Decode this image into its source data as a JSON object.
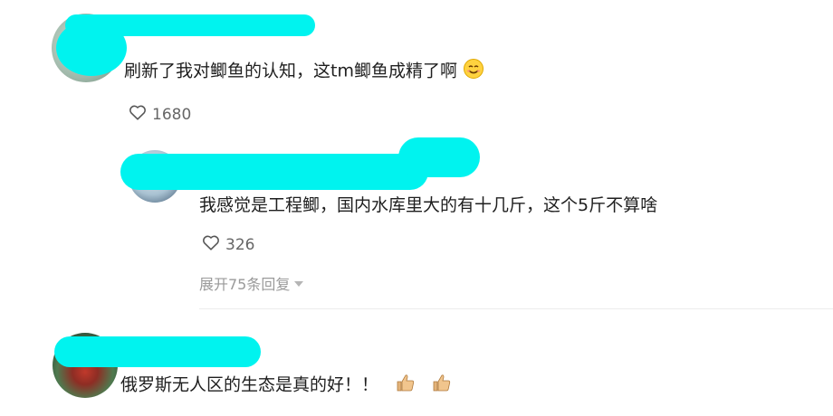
{
  "comments": [
    {
      "text": "刷新了我对鲫鱼的认知，这tm鲫鱼成精了啊",
      "emoji": "smile-emoji",
      "likes": "1680",
      "replies": [
        {
          "text": "我感觉是工程鲫，国内水库里大的有十几斤，这个5斤不算啥",
          "likes": "326",
          "expand_label": "展开75条回复"
        }
      ]
    },
    {
      "text": "俄罗斯无人区的生态是真的好！！",
      "emoji": "thumbs-up-emoji"
    }
  ],
  "colors": {
    "redaction": "#00f3ef",
    "muted": "#9a9a9a"
  }
}
